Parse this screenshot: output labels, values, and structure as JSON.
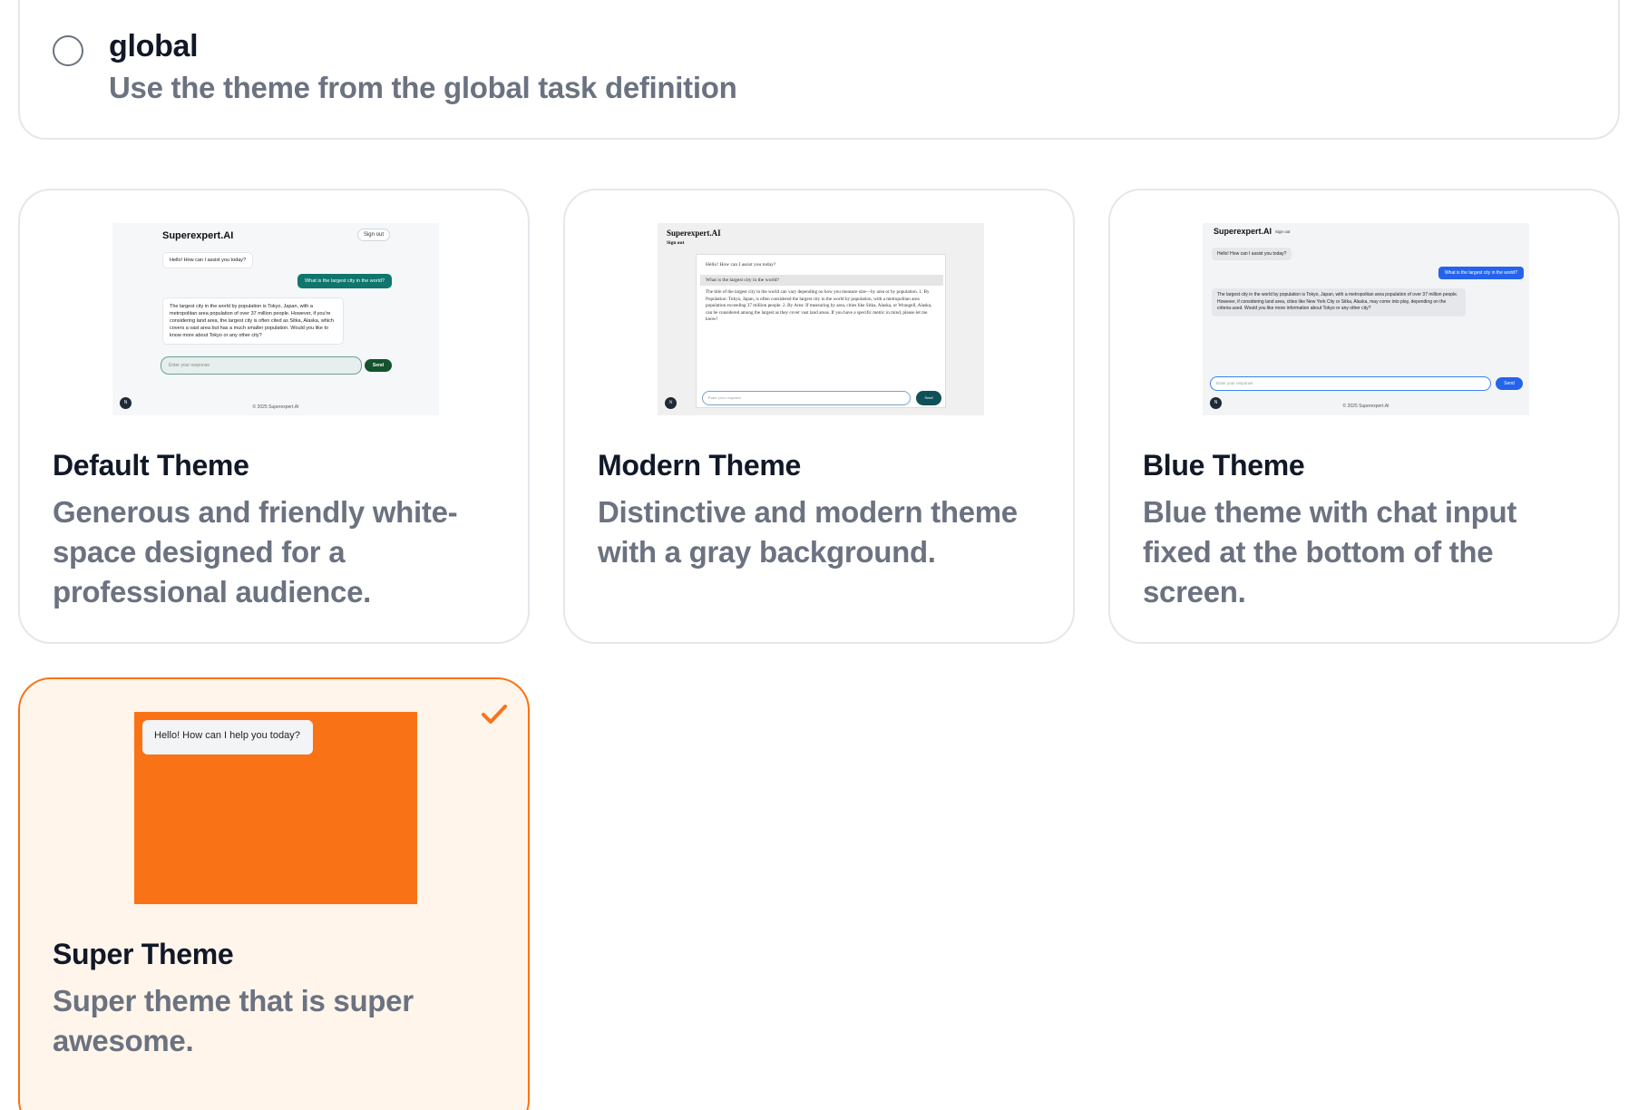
{
  "global_option": {
    "title": "global",
    "description": "Use the theme from the global task definition"
  },
  "themes": [
    {
      "title": "Default Theme",
      "description": "Generous and friendly white-space designed for a professional audience.",
      "selected": false,
      "preview": {
        "logo": "Superexpert.AI",
        "signout": "Sign out",
        "assistant_greeting": "Hello! How can I assist you today?",
        "user_message": "What is the largest city in the world?",
        "assistant_reply": "The largest city in the world by population is Tokyo, Japan, with a metropolitan area population of over 37 million people. However, if you're considering land area, the largest city is often cited as Sitka, Alaska, which covers a vast area but has a much smaller population. Would you like to know more about Tokyo or any other city?",
        "input_placeholder": "Enter your response",
        "send_label": "Send",
        "footer": "© 2025 Superexpert.AI",
        "avatar": "N",
        "accent_color": "#0f766e"
      }
    },
    {
      "title": "Modern Theme",
      "description": "Distinctive and modern theme with a gray background.",
      "selected": false,
      "preview": {
        "logo": "Superexpert.AI",
        "signout": "Sign out",
        "assistant_greeting": "Hello! How can I assist you today?",
        "user_message": "What is the largest city in the world?",
        "assistant_reply": "The title of the largest city in the world can vary depending on how you measure size—by area or by population. 1. By Population: Tokyo, Japan, is often considered the largest city in the world by population, with a metropolitan area population exceeding 37 million people. 2. By Area: If measuring by area, cities like Sitka, Alaska, or Wrangell, Alaska, can be considered among the largest as they cover vast land areas. If you have a specific metric in mind, please let me know!",
        "input_placeholder": "Enter your response",
        "send_label": "Send",
        "avatar": "N",
        "accent_color": "#0f5156"
      }
    },
    {
      "title": "Blue Theme",
      "description": "Blue theme with chat input fixed at the bottom of the screen.",
      "selected": false,
      "preview": {
        "logo": "Superexpert.AI",
        "signout": "Sign out",
        "assistant_greeting": "Hello! How can I assist you today?",
        "user_message": "What is the largest city in the world?",
        "assistant_reply": "The largest city in the world by population is Tokyo, Japan, with a metropolitan area population of over 37 million people. However, if considering land area, cities like New York City or Sitka, Alaska, may come into play, depending on the criteria used. Would you like more information about Tokyo or any other city?",
        "input_placeholder": "Enter your response",
        "send_label": "Send",
        "footer": "© 2025 Superexpert.AI",
        "avatar": "N",
        "accent_color": "#2563eb"
      }
    },
    {
      "title": "Super Theme",
      "description": "Super theme that is super awesome.",
      "selected": true,
      "preview": {
        "assistant_greeting": "Hello! How can I help you today?",
        "accent_color": "#f97316"
      }
    }
  ],
  "icons": {
    "radio": "radio-unchecked-icon",
    "selected": "checkmark-icon"
  },
  "colors": {
    "selected_border": "#f97316",
    "selected_background": "#fff5eb",
    "text_primary": "#111827",
    "text_secondary": "#6b7280"
  }
}
